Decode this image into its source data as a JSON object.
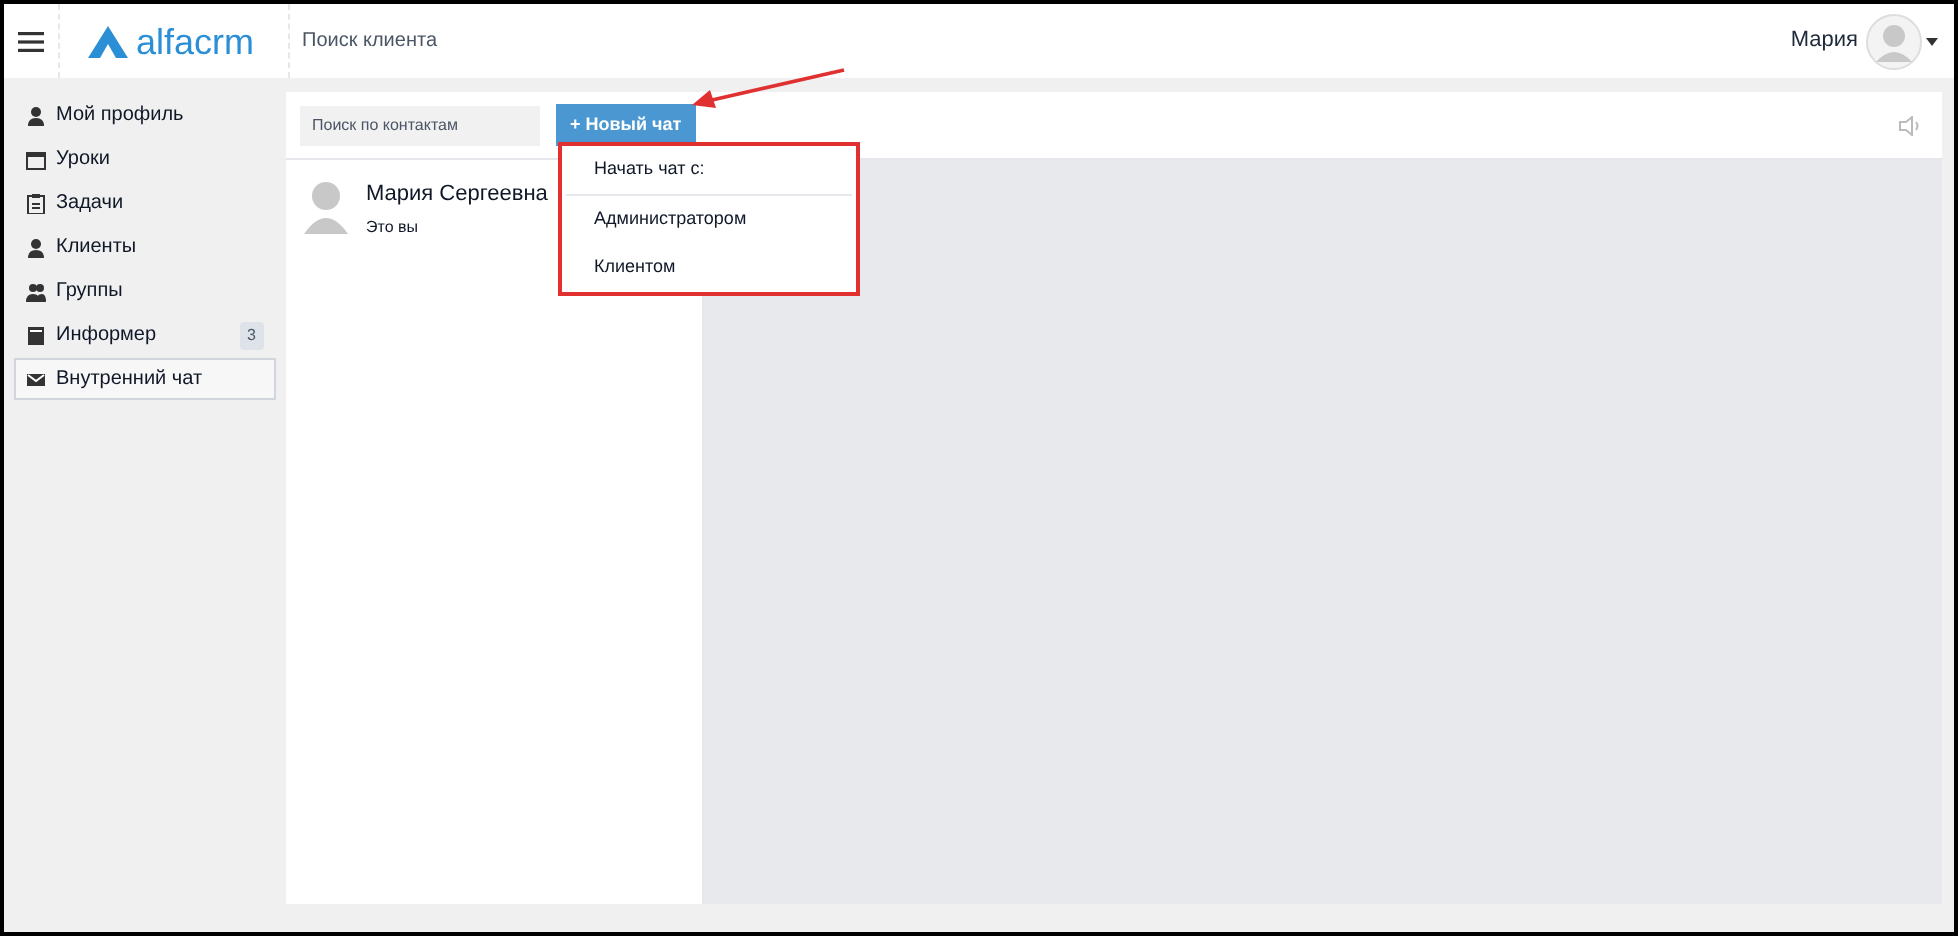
{
  "header": {
    "logo": "alfacrm",
    "search_placeholder": "Поиск клиента",
    "user_name": "Мария"
  },
  "sidebar": {
    "items": [
      {
        "label": "Мой профиль",
        "kind": "user",
        "selected": false
      },
      {
        "label": "Уроки",
        "kind": "calendar",
        "selected": false
      },
      {
        "label": "Задачи",
        "kind": "clipboard",
        "selected": false
      },
      {
        "label": "Клиенты",
        "kind": "user",
        "selected": false
      },
      {
        "label": "Группы",
        "kind": "group",
        "selected": false
      },
      {
        "label": "Информер",
        "kind": "book",
        "selected": false,
        "badge": "3"
      },
      {
        "label": "Внутренний чат",
        "kind": "mail",
        "selected": true
      }
    ]
  },
  "chat": {
    "search_placeholder": "Поиск по контактам",
    "new_chat_button": "+ Новый чат",
    "contacts": [
      {
        "name": "Мария Сергеевна",
        "subtitle": "Это вы"
      }
    ],
    "dropdown": {
      "header": "Начать чат с:",
      "items": [
        "Администратором",
        "Клиентом"
      ]
    }
  }
}
